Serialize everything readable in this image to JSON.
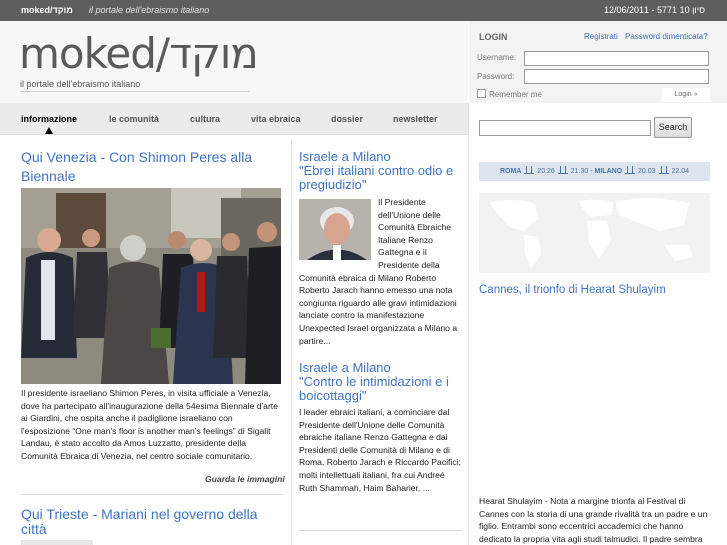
{
  "topbar": {
    "logo": "moked/מוקד",
    "tagline": "il portale dell'ebraismo italiano",
    "date": "12/06/2011 - 5771 10 סיון"
  },
  "header": {
    "brand": "moked/מוקד",
    "subtitle": "il portale dell'ebraismo italiano"
  },
  "nav": {
    "items": [
      "informazione",
      "le comunità",
      "cultura",
      "vita ebraica",
      "dossier",
      "newsletter"
    ],
    "active": "informazione"
  },
  "left_column": {
    "lead_title": "Qui Venezia - Con Shimon Peres alla Biennale",
    "lead_body": "Il presidente israeliano Shimon Peres, in visita ufficiale a Venezia, dove ha partecipato all'inaugurazione della 54esima Biennale d'arte ai Giardini, che ospita anche il padiglione israeliano con l'esposizione “One man's floor is another man's feelings” di Sigalit Landau, è stato accolto da Amos Luzzatto, presidente della Comunità Ebraica di Venezia, nel centro sociale comunitario.",
    "more_link": "Guarda le immagini",
    "second_title": "Qui Trieste - Mariani nel governo della città"
  },
  "middle_column": {
    "article1_title_line1": "Israele a Milano",
    "article1_title_line2": "\"Ebrei italiani contro odio e pregiudizio\"",
    "article1_body": "Il Presidente dell'Unione delle Comunità Ebraiche Italiane Renzo Gattegna e il Presidente della Comunità ebraica di Milano Roberto Roberto Jarach hanno emesso una nota congiunta riguardo alle gravi intimidazioni lanciate contro la manifestazione Unexpected Israel organizzata a Milano a partire...",
    "article2_title_line1": "Israele a Milano",
    "article2_title_line2": "\"Contro le intimidazioni e i boicottaggi\"",
    "article2_body": "I leader ebraici italiani, a cominciare dal Presidente dell'Unione delle Comunità ebraiche italiane Renzo Gattegna e dai Presidenti delle Comunità di Milano e di Roma, Roberto Jarach e Riccardo Pacifici; molti intellettuali italiani, fra cui Andreé Ruth Shammah, Haim Baharier, ..."
  },
  "sidebar": {
    "login_title": "LOGIN",
    "register_link": "Registrati",
    "forgot_link": "Password dimenticata?",
    "username_label": "Username:",
    "password_label": "Password:",
    "remember_label": "Remember me",
    "login_button": "Login »",
    "search_button": "Search",
    "weather": {
      "roma_label": "ROMA",
      "roma_in": "20.26",
      "roma_out": "21.30",
      "sep": "-",
      "milano_label": "MILANO",
      "milano_in": "20.03",
      "milano_out": "22.04"
    },
    "cannes_title": "Cannes, il trionfo di Hearat Shulayim",
    "cannes_body": "Hearat Shulayim - Nota a margine trionfa al Festival di Cannes con la storia di una grande rivalità tra un padre e un figlio. Entrambi sono eccentrici accademici che hanno dedicato la propria vita agli studi talmudici. Il padre sembra"
  },
  "colors": {
    "link_blue": "#3f74c4",
    "topbar_gray": "#5e5e5e",
    "weather_bg": "#dde4ee"
  }
}
